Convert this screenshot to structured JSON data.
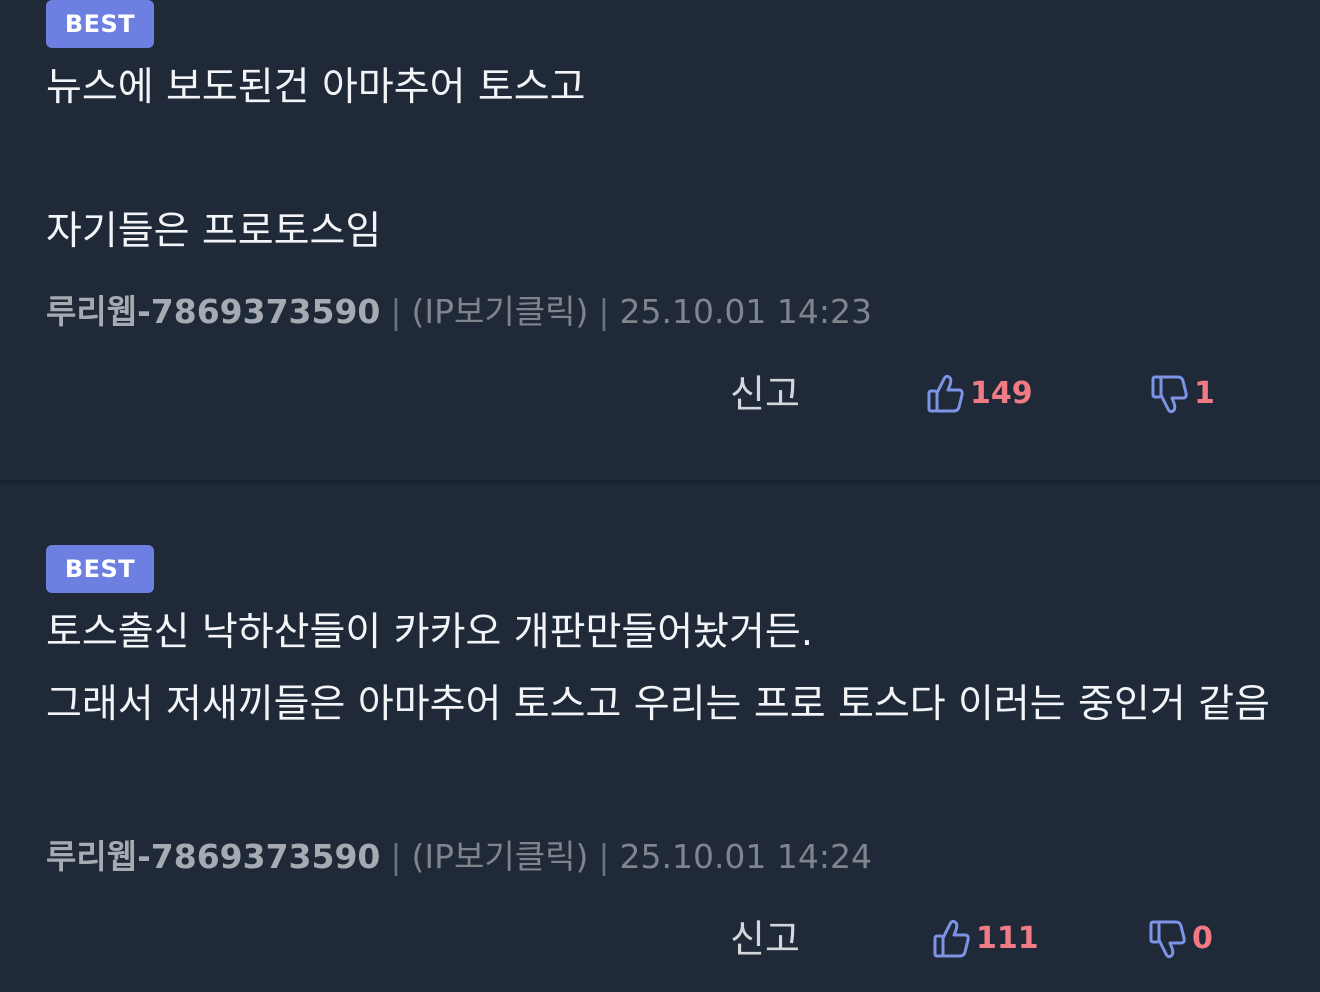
{
  "comments": [
    {
      "badge": "BEST",
      "body": "뉴스에 보도된건 아마추어 토스고\n\n자기들은 프로토스임",
      "author": "루리웹-7869373590",
      "separator": "|",
      "ip": "(IP보기클릭)",
      "date": "25.10.01 14:23",
      "report_label": "신고",
      "likes": "149",
      "dislikes": "1"
    },
    {
      "badge": "BEST",
      "body": "토스출신 낙하산들이 카카오 개판만들어놨거든.\n그래서 저새끼들은 아마추어 토스고 우리는 프로 토스다 이러는 중인거 같음",
      "author": "루리웹-7869373590",
      "separator": "|",
      "ip": "(IP보기클릭)",
      "date": "25.10.01 14:24",
      "report_label": "신고",
      "likes": "111",
      "dislikes": "0"
    }
  ],
  "icons": {
    "like": "thumbs-up-icon",
    "dislike": "thumbs-down-icon"
  },
  "colors": {
    "background": "#1f2937",
    "badge": "#6d7fe0",
    "count": "#f07b84",
    "icon": "#7d93e6"
  }
}
